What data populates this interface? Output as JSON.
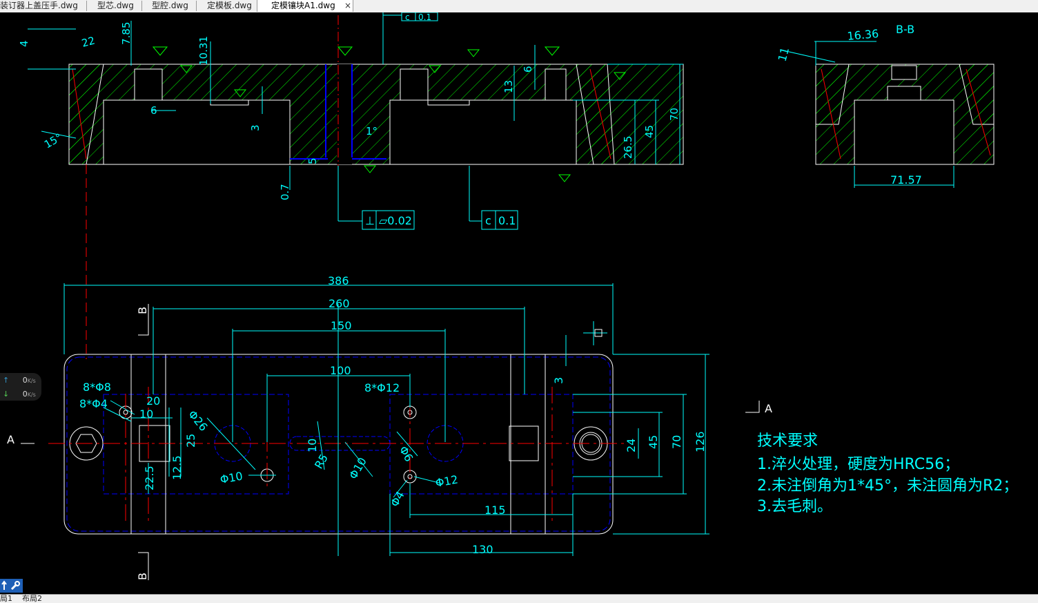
{
  "tabs": [
    {
      "label": "装订器上盖压手.dwg",
      "active": false
    },
    {
      "label": "型芯.dwg",
      "active": false
    },
    {
      "label": "型腔.dwg",
      "active": false
    },
    {
      "label": "定模板.dwg",
      "active": false
    },
    {
      "label": "定模镶块A1.dwg",
      "active": true
    }
  ],
  "tab_close_glyph": "×",
  "layout_tabs": [
    "局1",
    "布局2"
  ],
  "net_monitor": {
    "upload": {
      "arrow": "↑",
      "value": "0",
      "unit": "K/s"
    },
    "download": {
      "arrow": "↓",
      "value": "0",
      "unit": "K/s"
    }
  },
  "tool_icons": [
    "pin-icon",
    "wrench-icon"
  ],
  "colors": {
    "background": "#000000",
    "outline": "#ffffff",
    "dimension": "#00ffff",
    "hatch": "#00ff00",
    "centerline": "#ff0000",
    "hidden": "#0000ff",
    "tab_bar": "#f0f0f0"
  },
  "drawing": {
    "section_title": "B-B",
    "section_label_A": "A",
    "section_label_B": "B",
    "dims_top": [
      "22",
      "7.85",
      "4",
      "10.31",
      "6",
      "3",
      "15°",
      "0.7",
      "5",
      "1°",
      "6",
      "13",
      "26.5",
      "45",
      "70",
      "11",
      "16.36",
      "71.57"
    ],
    "tolerance_1": {
      "symbol": "⊥",
      "value": "⏥0.02"
    },
    "tolerance_2": {
      "symbol": "c",
      "value": "0.1"
    },
    "tolerance_3": {
      "symbol": "c",
      "value": "0.1"
    },
    "dims_plan": [
      "386",
      "260",
      "150",
      "100",
      "3",
      "8*Φ8",
      "8*Φ4",
      "20",
      "10",
      "Φ26",
      "25",
      "12.5",
      "22.5",
      "Φ10",
      "10",
      "R5",
      "Φ10",
      "8*Φ12",
      "Φ6",
      "Φ12",
      "Φ4",
      "24",
      "45",
      "70",
      "126",
      "115",
      "130"
    ],
    "notes_title": "技术要求",
    "notes": [
      "1.淬火处理，硬度为HRC56；",
      "2.未注倒角为1*45°，未注圆角为R2；",
      "3.去毛刺。"
    ]
  }
}
